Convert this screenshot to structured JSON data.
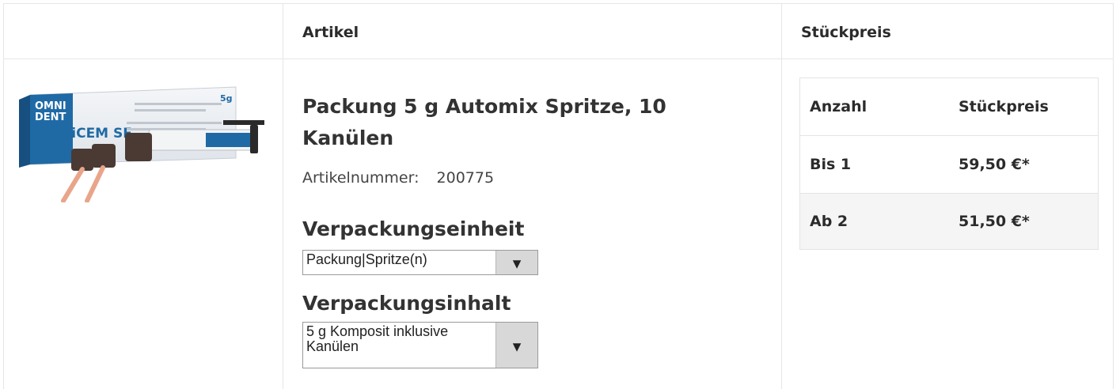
{
  "header": {
    "col_article": "Artikel",
    "col_price": "Stückpreis"
  },
  "product": {
    "image_alt": "OmniCEM SE",
    "image_brand_top": "OMNI",
    "image_brand_bottom": "DENT",
    "image_product_name": "OmniCEM SE",
    "image_size": "5g",
    "title": "Packung 5 g Automix Spritze, 10 Kanülen",
    "article_number_label": "Artikelnummer:",
    "article_number": "200775"
  },
  "packaging_unit": {
    "label": "Verpackungseinheit",
    "selected": "Packung|Spritze(n)"
  },
  "packaging_content": {
    "label": "Verpackungsinhalt",
    "selected": "5 g Komposit inklusive Kanülen"
  },
  "price_table": {
    "headers": {
      "quantity": "Anzahl",
      "unit_price": "Stückpreis"
    },
    "rows": [
      {
        "quantity": "Bis 1",
        "price": "59,50 €*"
      },
      {
        "quantity": "Ab 2",
        "price": "51,50 €*"
      }
    ]
  },
  "colors": {
    "border": "#e6e6e6",
    "alt_row": "#f5f5f5",
    "brand_blue": "#1f6aa5"
  }
}
